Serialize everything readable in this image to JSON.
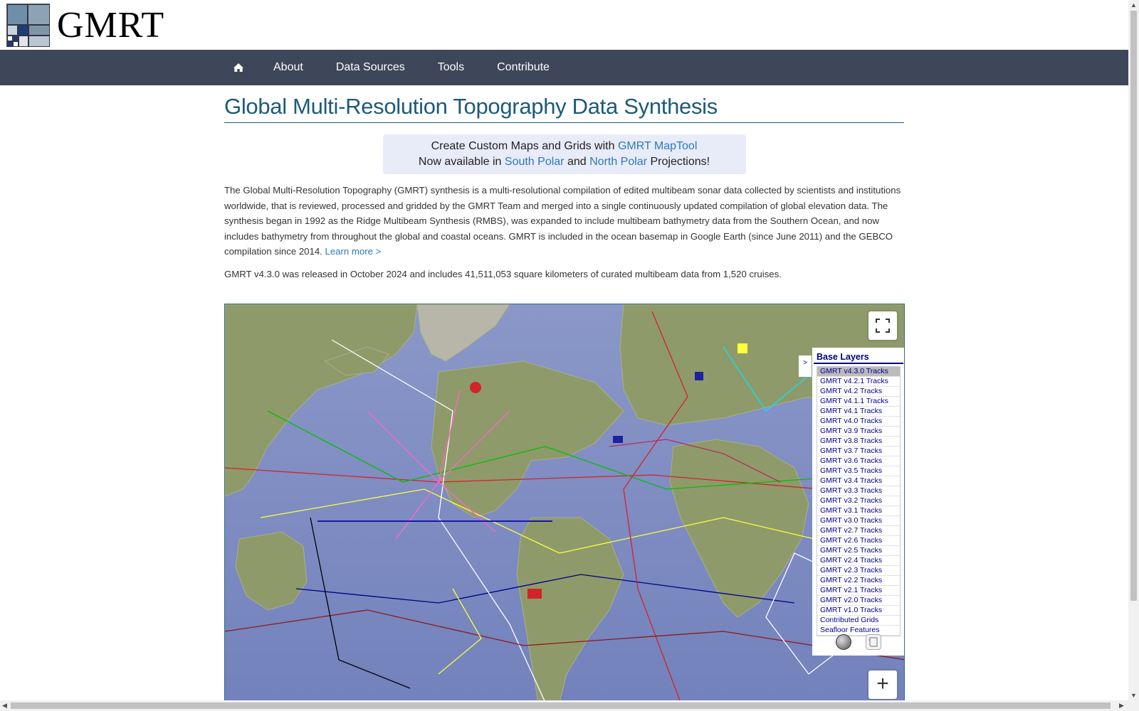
{
  "header": {
    "logo_text": "GMRT"
  },
  "nav": {
    "items": [
      {
        "label": "About"
      },
      {
        "label": "Data Sources"
      },
      {
        "label": "Tools"
      },
      {
        "label": "Contribute"
      }
    ]
  },
  "main": {
    "title": "Global Multi-Resolution Topography Data Synthesis",
    "promo": {
      "line1_prefix": "Create Custom Maps and Grids with",
      "line1_link": "GMRT MapTool",
      "line2_prefix": "Now available in",
      "south_link": "South Polar",
      "and": "and",
      "north_link": "North Polar",
      "line2_suffix": "Projections!"
    },
    "description": "The Global Multi-Resolution Topography (GMRT) synthesis is a multi-resolutional compilation of edited multibeam sonar data collected by scientists and institutions worldwide, that is reviewed, processed and gridded by the GMRT Team and merged into a single continuously updated compilation of global elevation data. The synthesis began in 1992 as the Ridge Multibeam Synthesis (RMBS), was expanded to include multibeam bathymetry data from the Southern Ocean, and now includes bathymetry from throughout the global and coastal oceans. GMRT is included in the ocean basemap in Google Earth (since June 2011) and the GEBCO compilation since 2014.",
    "learn_more": "Learn more >",
    "release": "GMRT v4.3.0 was released in October 2024 and includes 41,511,053 square kilometers of curated multibeam data from 1,520 cruises."
  },
  "map": {
    "toggle_label": ">",
    "zoom_in_label": "+",
    "layers_title": "Base Layers",
    "layers": [
      {
        "label": "GMRT v4.3.0 Tracks",
        "active": true
      },
      {
        "label": "GMRT v4.2.1 Tracks"
      },
      {
        "label": "GMRT v4.2 Tracks"
      },
      {
        "label": "GMRT v4.1.1 Tracks"
      },
      {
        "label": "GMRT v4.1 Tracks"
      },
      {
        "label": "GMRT v4.0 Tracks"
      },
      {
        "label": "GMRT v3.9 Tracks"
      },
      {
        "label": "GMRT v3.8 Tracks"
      },
      {
        "label": "GMRT v3.7 Tracks"
      },
      {
        "label": "GMRT v3.6 Tracks"
      },
      {
        "label": "GMRT v3.5 Tracks"
      },
      {
        "label": "GMRT v3.4 Tracks"
      },
      {
        "label": "GMRT v3.3 Tracks"
      },
      {
        "label": "GMRT v3.2 Tracks"
      },
      {
        "label": "GMRT v3.1 Tracks"
      },
      {
        "label": "GMRT v3.0 Tracks"
      },
      {
        "label": "GMRT v2.7 Tracks"
      },
      {
        "label": "GMRT v2.6 Tracks"
      },
      {
        "label": "GMRT v2.5 Tracks"
      },
      {
        "label": "GMRT v2.4 Tracks"
      },
      {
        "label": "GMRT v2.3 Tracks"
      },
      {
        "label": "GMRT v2.2 Tracks"
      },
      {
        "label": "GMRT v2.1 Tracks"
      },
      {
        "label": "GMRT v2.0 Tracks"
      },
      {
        "label": "GMRT v1.0 Tracks"
      },
      {
        "label": "Contributed Grids"
      },
      {
        "label": "Seafloor Features"
      }
    ],
    "icons": [
      "globe-icon",
      "scroll-icon"
    ]
  },
  "colors": {
    "nav_bg": "#3e4659",
    "title": "#1d5a7a",
    "link": "#2f79b7",
    "promo_bg": "#e8ebf8",
    "layer_text": "#00008b",
    "ocean": "#7f8dc2",
    "land": "#8f9a6a"
  }
}
